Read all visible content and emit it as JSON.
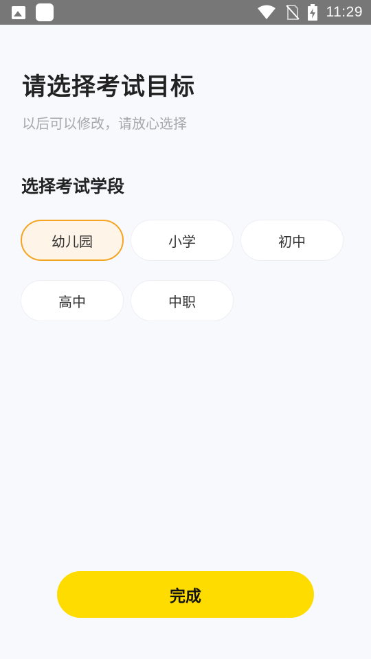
{
  "status_bar": {
    "time": "11:29",
    "icons": [
      "image-icon",
      "app-icon",
      "wifi-icon",
      "no-sim-icon",
      "battery-charging-icon"
    ]
  },
  "header": {
    "title": "请选择考试目标",
    "subtitle": "以后可以修改，请放心选择"
  },
  "section": {
    "label": "选择考试学段",
    "options": [
      {
        "label": "幼儿园",
        "selected": true
      },
      {
        "label": "小学",
        "selected": false
      },
      {
        "label": "初中",
        "selected": false
      },
      {
        "label": "高中",
        "selected": false
      },
      {
        "label": "中职",
        "selected": false
      }
    ]
  },
  "footer": {
    "done_label": "完成"
  },
  "colors": {
    "accent": "#ffdc00",
    "selected_border": "#f4a521",
    "selected_bg": "#fff4e8"
  }
}
